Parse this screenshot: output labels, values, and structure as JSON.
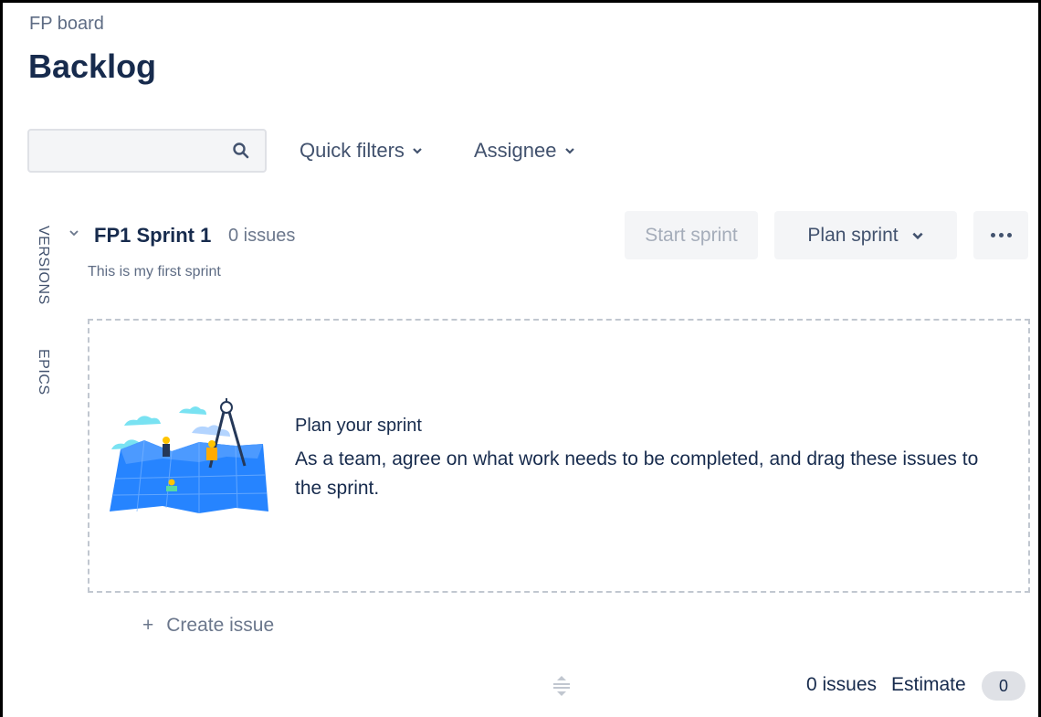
{
  "header": {
    "breadcrumb": "FP board",
    "title": "Backlog"
  },
  "toolbar": {
    "search": {
      "value": "",
      "placeholder": "",
      "icon": "search-icon"
    },
    "quick_filters_label": "Quick filters",
    "assignee_label": "Assignee"
  },
  "side_tabs": [
    {
      "label": "VERSIONS"
    },
    {
      "label": "EPICS"
    }
  ],
  "sprint": {
    "name": "FP1 Sprint 1",
    "issue_count": "0 issues",
    "description": "This is my first sprint",
    "start_label": "Start sprint",
    "plan_label": "Plan sprint",
    "more_icon": "more-icon"
  },
  "empty_state": {
    "title": "Plan your sprint",
    "body": "As a team, agree on what work needs to be completed, and drag these issues to the sprint."
  },
  "create_issue": {
    "icon": "+",
    "label": "Create issue"
  },
  "footer": {
    "issue_count": "0 issues",
    "estimate_label": "Estimate",
    "estimate_value": "0"
  },
  "colors": {
    "text": "#172b4d",
    "muted": "#6b778c",
    "button_bg": "#f4f5f7",
    "disabled_text": "#a5adba",
    "illustration_blue": "#2684ff"
  }
}
